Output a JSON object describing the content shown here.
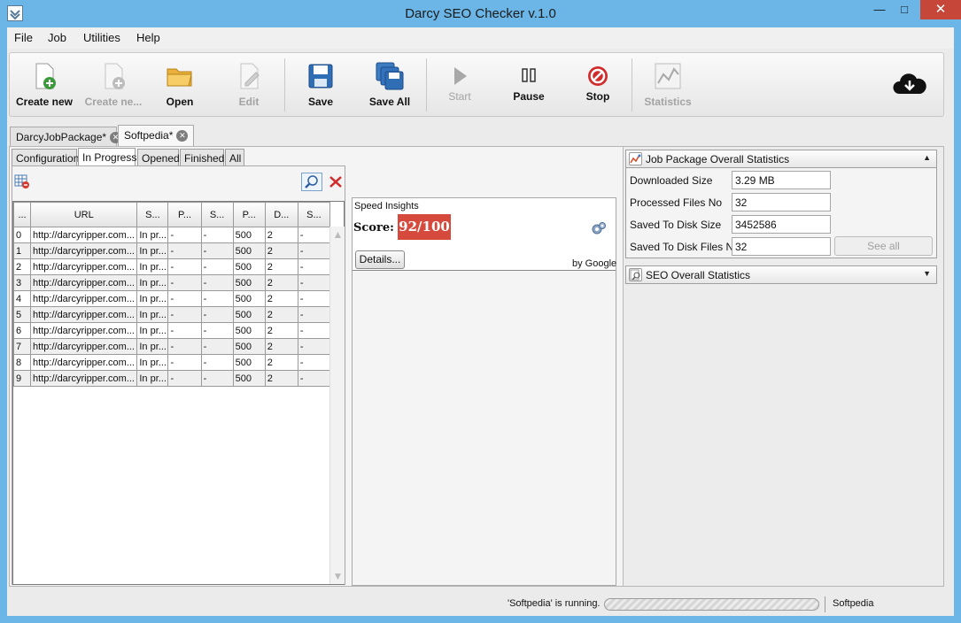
{
  "window": {
    "title": "Darcy SEO Checker v.1.0"
  },
  "menu": [
    "File",
    "Job",
    "Utilities",
    "Help"
  ],
  "toolbar": {
    "create_new": "Create new",
    "create_ne_disabled": "Create ne...",
    "open": "Open",
    "edit": "Edit",
    "save": "Save",
    "save_all": "Save All",
    "start": "Start",
    "pause": "Pause",
    "stop": "Stop",
    "statistics": "Statistics"
  },
  "doc_tabs": [
    "DarcyJobPackage*",
    "Softpedia*"
  ],
  "sub_tabs": [
    "Configuration",
    "In Progress",
    "Opened",
    "Finished",
    "All"
  ],
  "grid": {
    "columns": [
      "...",
      "URL",
      "S...",
      "P...",
      "S...",
      "P...",
      "D...",
      "S..."
    ],
    "rows": [
      [
        "0",
        "http://darcyripper.com...",
        "In pr...",
        "-",
        "-",
        "500",
        "2",
        "-"
      ],
      [
        "1",
        "http://darcyripper.com...",
        "In pr...",
        "-",
        "-",
        "500",
        "2",
        "-"
      ],
      [
        "2",
        "http://darcyripper.com...",
        "In pr...",
        "-",
        "-",
        "500",
        "2",
        "-"
      ],
      [
        "3",
        "http://darcyripper.com...",
        "In pr...",
        "-",
        "-",
        "500",
        "2",
        "-"
      ],
      [
        "4",
        "http://darcyripper.com...",
        "In pr...",
        "-",
        "-",
        "500",
        "2",
        "-"
      ],
      [
        "5",
        "http://darcyripper.com...",
        "In pr...",
        "-",
        "-",
        "500",
        "2",
        "-"
      ],
      [
        "6",
        "http://darcyripper.com...",
        "In pr...",
        "-",
        "-",
        "500",
        "2",
        "-"
      ],
      [
        "7",
        "http://darcyripper.com...",
        "In pr...",
        "-",
        "-",
        "500",
        "2",
        "-"
      ],
      [
        "8",
        "http://darcyripper.com...",
        "In pr...",
        "-",
        "-",
        "500",
        "2",
        "-"
      ],
      [
        "9",
        "http://darcyripper.com...",
        "In pr...",
        "-",
        "-",
        "500",
        "2",
        "-"
      ]
    ]
  },
  "speed": {
    "title": "Speed Insights",
    "score_label": "Score:",
    "score_value": "92/100",
    "details": "Details...",
    "by": "by Google"
  },
  "stats": {
    "title": "Job Package Overall Statistics",
    "downloaded_size_label": "Downloaded Size",
    "downloaded_size": "3.29 MB",
    "processed_files_label": "Processed Files No",
    "processed_files": "32",
    "saved_disk_size_label": "Saved To Disk Size",
    "saved_disk_size": "3452586",
    "saved_disk_files_label": "Saved To Disk Files No",
    "saved_disk_files": "32",
    "see_all": "See all"
  },
  "seo_stats": {
    "title": "SEO Overall Statistics"
  },
  "status": {
    "message": "'Softpedia' is running.",
    "job": "Softpedia"
  },
  "colors": {
    "score_bg": "#d54a3c",
    "title_bar": "#6bb6e6",
    "close_button": "#c7463a"
  }
}
